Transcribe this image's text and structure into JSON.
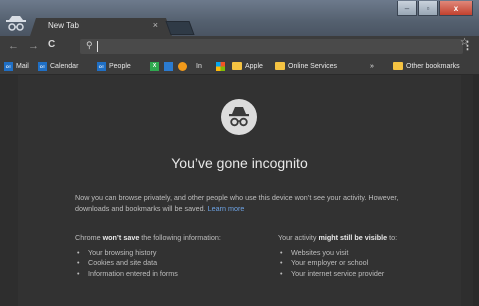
{
  "tab": {
    "title": "New Tab",
    "close": "×"
  },
  "window_controls": {
    "minimize": "–",
    "maximize": "▫",
    "close": "x"
  },
  "toolbar": {
    "back": "←",
    "forward": "→",
    "reload": "C",
    "omnibox_value": ""
  },
  "bookmarks": {
    "items": [
      {
        "label": "Mail",
        "icon": "outlook-icon"
      },
      {
        "label": "Calendar",
        "icon": "outlook-icon"
      },
      {
        "label": "People",
        "icon": "outlook-icon"
      },
      {
        "label": "",
        "icon": "excel-icon"
      },
      {
        "label": "",
        "icon": "link-icon"
      },
      {
        "label": "",
        "icon": "orange-circle-icon"
      },
      {
        "label": "In",
        "icon": ""
      },
      {
        "label": "",
        "icon": "microsoft-icon"
      },
      {
        "label": "Apple",
        "icon": "folder-icon"
      },
      {
        "label": "Online Services",
        "icon": "folder-icon"
      }
    ],
    "overflow": "»",
    "other": "Other bookmarks",
    "outlook_letters": "O≡"
  },
  "page": {
    "heading": "You’ve gone incognito",
    "paragraph": "Now you can browse privately, and other people who use this device won’t see your activity. However, downloads and bookmarks will be saved.",
    "learn_more": "Learn more",
    "left_col": {
      "prefix": "Chrome ",
      "bold": "won’t save",
      "suffix": " the following information:",
      "items": [
        "Your browsing history",
        "Cookies and site data",
        "Information entered in forms"
      ]
    },
    "right_col": {
      "prefix": "Your activity ",
      "bold": "might still be visible",
      "suffix": " to:",
      "items": [
        "Websites you visit",
        "Your employer or school",
        "Your internet service provider"
      ]
    }
  },
  "colors": {
    "background": "#323232",
    "link": "#6ea4e6",
    "text": "#bdbdbd"
  }
}
